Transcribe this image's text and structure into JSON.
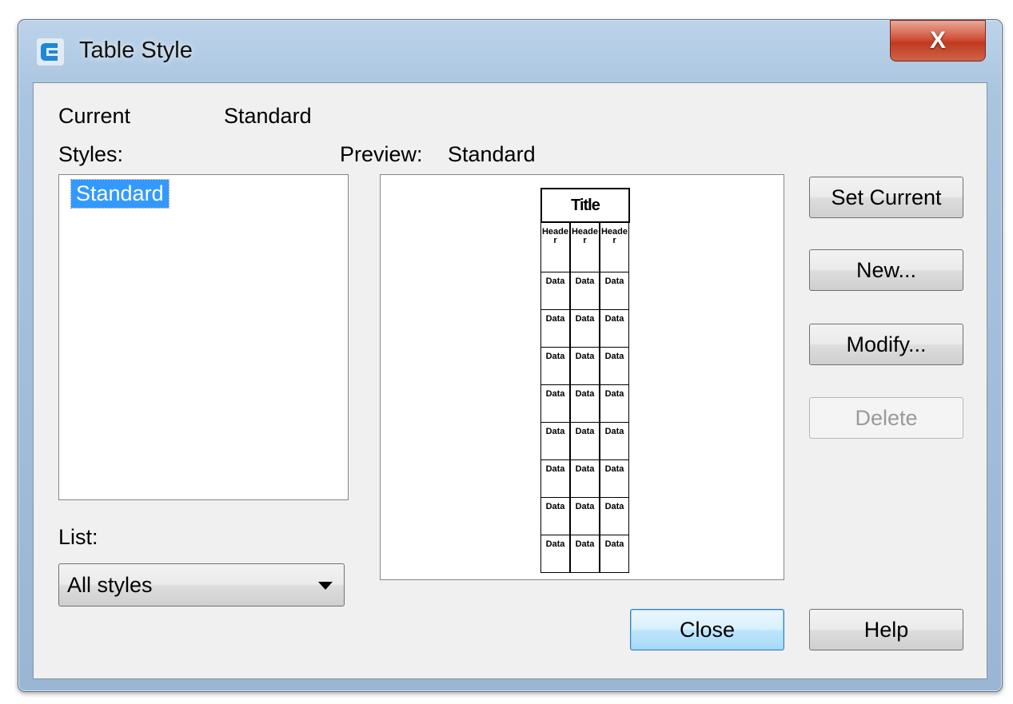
{
  "window": {
    "title": "Table Style",
    "close_glyph": "X",
    "icon": "app-c-logo-icon"
  },
  "current": {
    "label": "Current",
    "value": "Standard"
  },
  "styles": {
    "label": "Styles:",
    "items": [
      "Standard"
    ],
    "selected": "Standard"
  },
  "preview": {
    "label": "Preview:",
    "value": "Standard",
    "table_title": "Title",
    "header_text": "Header",
    "data_text": "Data",
    "data_rows": 8,
    "columns": 3
  },
  "list": {
    "label": "List:",
    "selected": "All styles"
  },
  "buttons": {
    "set_current": "Set Current",
    "new": "New...",
    "modify": "Modify...",
    "delete": "Delete",
    "close": "Close",
    "help": "Help"
  },
  "colors": {
    "selection": "#3399ff",
    "close_button": "#c0391f",
    "dialog_bg": "#f0f0f0"
  }
}
